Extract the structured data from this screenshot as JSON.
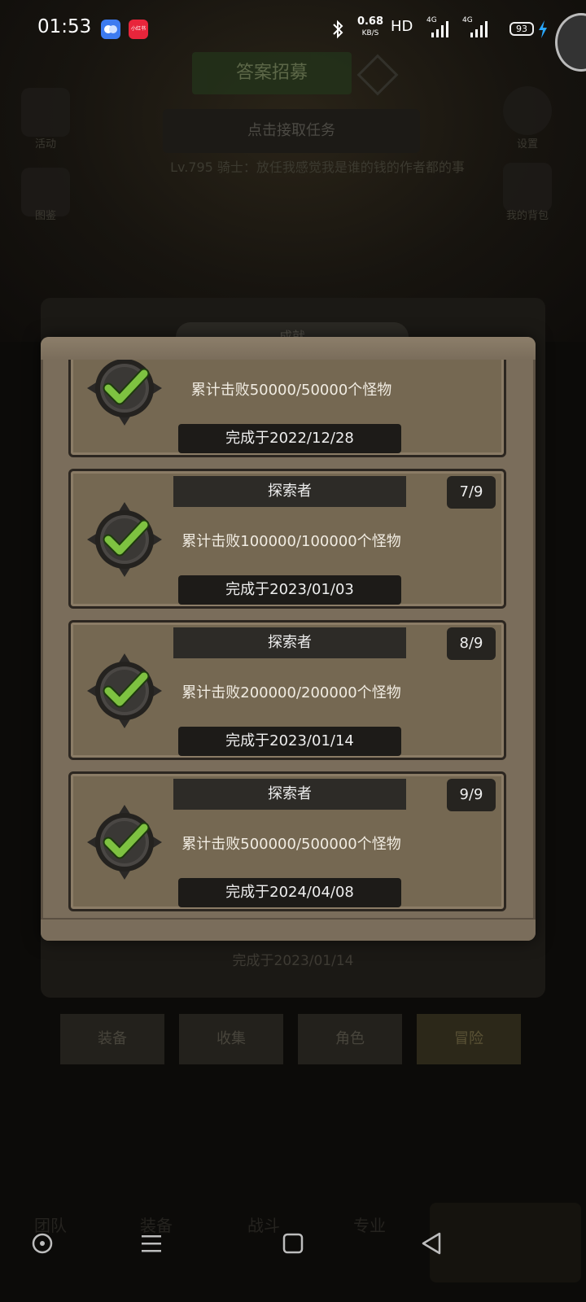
{
  "status_bar": {
    "time": "01:53",
    "app_badge_2": "小红书",
    "net_speed_value": "0.68",
    "net_speed_unit": "KB/S",
    "hd_label": "HD",
    "signal_label_1": "4G",
    "signal_label_2": "4G",
    "battery": "93"
  },
  "background": {
    "top_title": "答案招募",
    "quest_button": "点击接取任务",
    "status_line": "Lv.795 骑士：放任我感觉我是谁的钱的作者都的事",
    "side_left_1": "活动",
    "side_left_2": "图鉴",
    "side_right_1": "设置",
    "side_right_2": "我的背包",
    "panel_title": "成就",
    "ghost_date": "完成于2023/01/14",
    "tabs": [
      "装备",
      "收集",
      "角色",
      "冒险"
    ],
    "bottom_nav": [
      "团队",
      "装备",
      "战斗",
      "专业"
    ]
  },
  "modal": {
    "cards": [
      {
        "title": "",
        "progress": "",
        "description": "累计击败50000/50000个怪物",
        "date": "完成于2022/12/28"
      },
      {
        "title": "探索者",
        "progress": "7/9",
        "description": "累计击败100000/100000个怪物",
        "date": "完成于2023/01/03"
      },
      {
        "title": "探索者",
        "progress": "8/9",
        "description": "累计击败200000/200000个怪物",
        "date": "完成于2023/01/14"
      },
      {
        "title": "探索者",
        "progress": "9/9",
        "description": "累计击败500000/500000个怪物",
        "date": "完成于2024/04/08"
      }
    ]
  },
  "colors": {
    "modal_bg": "#7a6d5b",
    "checkmark": "#7ec241",
    "badge_dark": "#3a3835"
  },
  "icons": {
    "badge": "check-medal-icon",
    "nav_home": "circle-dot-icon",
    "nav_menu": "menu-icon",
    "nav_square": "square-icon",
    "nav_back": "back-triangle-icon"
  }
}
